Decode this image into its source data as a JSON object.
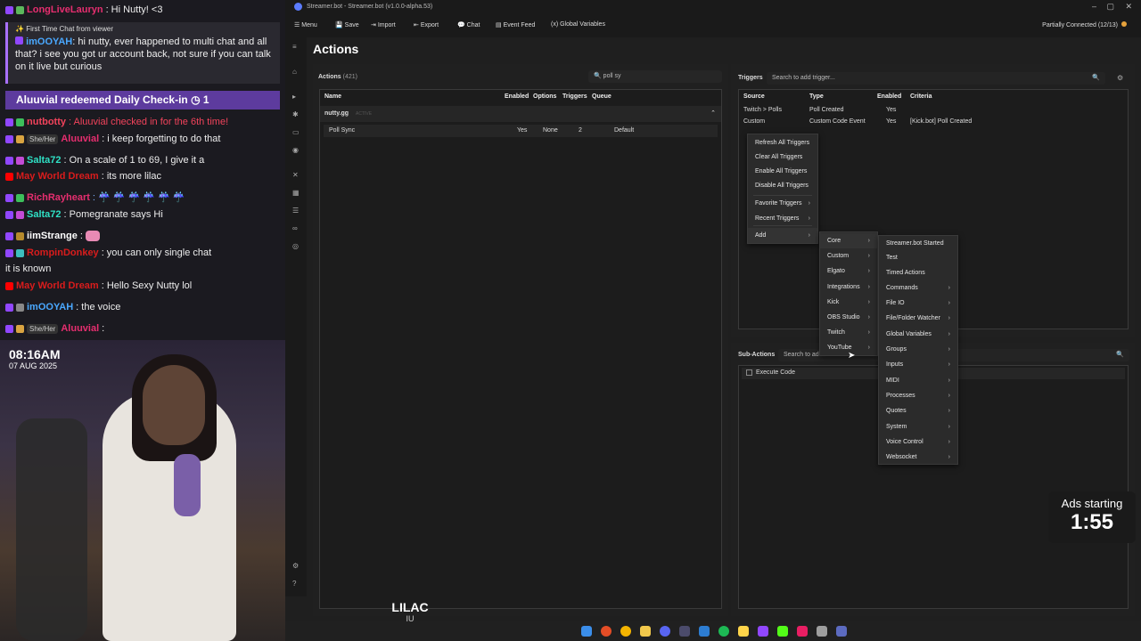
{
  "chat": {
    "lines": [
      {
        "user": "LongLiveLauryn",
        "text": ": Hi Nutty! <3",
        "color": "#e62e6f"
      },
      {
        "user": "nutbotty",
        "text": ": Aluuvial checked in for the 6th time!",
        "color": "#f2435b"
      },
      {
        "user": "Aluuvial",
        "pronoun": "She/Her",
        "text": ": i keep forgetting to do that",
        "color": "#e62e6f"
      },
      {
        "user": "Salta72",
        "text": ": On a scale of 1 to 69, I give it a",
        "color": "#2fe0c5"
      },
      {
        "user": "May World Dream",
        "text": ": its more lilac",
        "color": "#d91c1c"
      },
      {
        "user": "RichRayheart",
        "text": ": ☔ ☔ ☔ ☔ ☔ ☔",
        "color": "#e62e6f"
      },
      {
        "user": "Salta72",
        "text": ": Pomegranate says Hi",
        "color": "#2fe0c5"
      },
      {
        "user": "iimStrange",
        "text": ":",
        "color": "#ffffff"
      },
      {
        "user": "RompinDonkey",
        "text": ": you can only single chat",
        "color": "#d91c1c"
      },
      {
        "user": "",
        "text": "it is known",
        "color": "#ffffff"
      },
      {
        "user": "May World Dream",
        "text": ": Hello Sexy Nutty lol",
        "color": "#d91c1c"
      },
      {
        "user": "imOOYAH",
        "text": ": the voice",
        "color": "#4aa8ff"
      },
      {
        "user": "Aluuvial",
        "pronoun": "She/Her",
        "text": ":",
        "color": "#e62e6f"
      }
    ],
    "first_time": {
      "header": "First Time Chat from viewer",
      "user": "imOOYAH",
      "text": ": hi nutty, ever happened to multi chat and all that? i see you got ur account back, not sure if you can talk on it live but curious"
    },
    "redeem": "Aluuvial redeemed Daily Check-in ◷ 1"
  },
  "cam": {
    "time": "08:16AM",
    "date": "07 AUG 2025"
  },
  "app": {
    "title": "Streamer.bot - Streamer.bot (v1.0.0-alpha.53)",
    "menu": [
      "Menu",
      "Save",
      "Import",
      "Export",
      "Chat",
      "Event Feed",
      "Global Variables"
    ],
    "connection": "Partially Connected (12/13)",
    "page_title": "Actions"
  },
  "actions": {
    "label": "Actions",
    "count": "(421)",
    "search_value": "poll sy",
    "columns": [
      "Name",
      "Enabled",
      "Options",
      "Triggers",
      "Queue"
    ],
    "group": "nutty.gg",
    "group_tag": "ACTIVE",
    "rows": [
      {
        "name": "Poll Sync",
        "enabled": "Yes",
        "options": "None",
        "triggers": "2",
        "queue": "Default"
      }
    ]
  },
  "triggers": {
    "label": "Triggers",
    "search_placeholder": "Search to add trigger...",
    "columns": [
      "Source",
      "Type",
      "Enabled",
      "Criteria"
    ],
    "rows": [
      {
        "source": "Twitch > Polls",
        "type": "Poll Created",
        "enabled": "Yes",
        "criteria": ""
      },
      {
        "source": "Custom",
        "type": "Custom Code Event",
        "enabled": "Yes",
        "criteria": "[Kick.bot] Poll Created"
      }
    ]
  },
  "trigger_menu": [
    "Refresh All Triggers",
    "Clear All Triggers",
    "Enable All Triggers",
    "Disable All Triggers",
    "Favorite Triggers",
    "Recent Triggers",
    "Add"
  ],
  "add_menu": [
    "Core",
    "Custom",
    "Elgato",
    "Integrations",
    "Kick",
    "OBS Studio",
    "Twitch",
    "YouTube"
  ],
  "core_menu": [
    "Streamer.bot Started",
    "Test",
    "Timed Actions",
    "Commands",
    "File IO",
    "File/Folder Watcher",
    "Global Variables",
    "Groups",
    "Inputs",
    "MIDI",
    "Processes",
    "Quotes",
    "System",
    "Voice Control",
    "Websocket"
  ],
  "sub_actions": {
    "label": "Sub-Actions",
    "search_placeholder": "Search to add sub-action...",
    "items": [
      "Execute Code"
    ]
  },
  "ads": {
    "label": "Ads starting",
    "time": "1:55"
  },
  "song": {
    "title": "LILAC",
    "artist": "IU"
  }
}
